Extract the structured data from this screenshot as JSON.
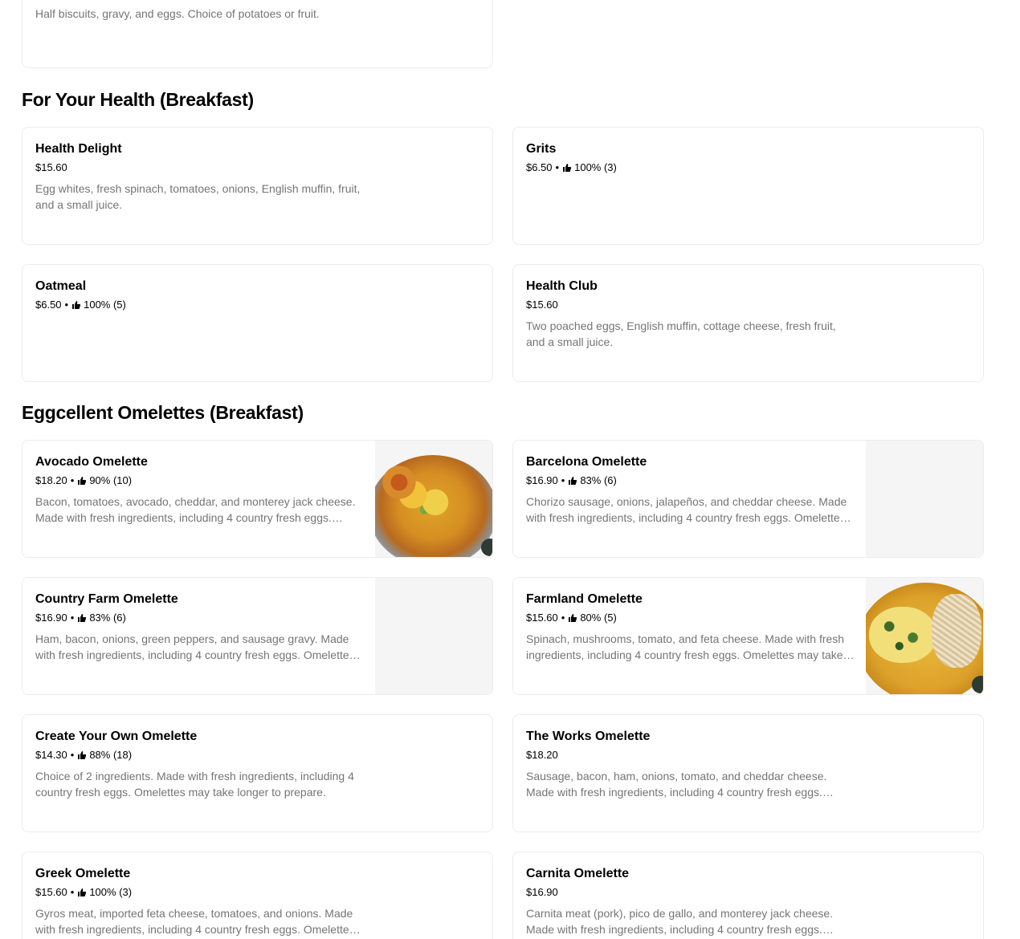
{
  "top_card": {
    "description": "Half biscuits, gravy, and eggs. Choice of potatoes or fruit."
  },
  "sections": [
    {
      "title": "For Your Health (Breakfast)",
      "items": [
        {
          "name": "Health Delight",
          "price": "$15.60",
          "rating": "",
          "description": "Egg whites, fresh spinach, tomatoes, onions, English muffin, fruit, and a small juice."
        },
        {
          "name": "Grits",
          "price": "$6.50",
          "rating": "100% (3)",
          "description": ""
        },
        {
          "name": "Oatmeal",
          "price": "$6.50",
          "rating": "100% (5)",
          "description": ""
        },
        {
          "name": "Health Club",
          "price": "$15.60",
          "rating": "",
          "description": "Two poached eggs, English muffin, cottage cheese, fresh fruit, and a small juice."
        }
      ]
    },
    {
      "title": "Eggcellent Omelettes (Breakfast)",
      "items": [
        {
          "name": "Avocado Omelette",
          "price": "$18.20",
          "rating": "90% (10)",
          "description": "Bacon, tomatoes, avocado, cheddar, and monterey jack cheese. Made with fresh ingredients, including 4 country fresh eggs. Omelettes may take longer to prepare."
        },
        {
          "name": "Barcelona Omelette",
          "price": "$16.90",
          "rating": "83% (6)",
          "description": "Chorizo sausage, onions, jalapeños, and cheddar cheese. Made with fresh ingredients, including 4 country fresh eggs. Omelettes may take longer to prepare."
        },
        {
          "name": "Country Farm Omelette",
          "price": "$16.90",
          "rating": "83% (6)",
          "description": "Ham, bacon, onions, green peppers, and sausage gravy. Made with fresh ingredients, including 4 country fresh eggs. Omelettes may take longer to prepare."
        },
        {
          "name": "Farmland Omelette",
          "price": "$15.60",
          "rating": "80% (5)",
          "description": "Spinach, mushrooms, tomato, and feta cheese. Made with fresh ingredients, including 4 country fresh eggs. Omelettes may take longer to prepare."
        },
        {
          "name": "Create Your Own Omelette",
          "price": "$14.30",
          "rating": "88% (18)",
          "description": "Choice of 2 ingredients. Made with fresh ingredients, including 4 country fresh eggs. Omelettes may take longer to prepare."
        },
        {
          "name": "The Works Omelette",
          "price": "$18.20",
          "rating": "",
          "description": "Sausage, bacon, ham, onions, tomato, and cheddar cheese. Made with fresh ingredients, including 4 country fresh eggs. Omelettes may take longer to prepare."
        },
        {
          "name": "Greek Omelette",
          "price": "$15.60",
          "rating": "100% (3)",
          "description": "Gyros meat, imported feta cheese, tomatoes, and onions. Made with fresh ingredients, including 4 country fresh eggs. Omelettes may take longer to prepare."
        },
        {
          "name": "Carnita Omelette",
          "price": "$16.90",
          "rating": "",
          "description": "Carnita meat (pork), pico de gallo, and monterey jack cheese. Made with fresh ingredients, including 4 country fresh eggs. Omelettes may take longer to prepare."
        }
      ]
    }
  ],
  "icons": {
    "rating": "thumbs-up-icon",
    "image_badge": "badge-icon"
  },
  "colors": {
    "text": "#000000",
    "muted": "#757575",
    "border": "#ececec",
    "placeholder": "#f5f5f5"
  }
}
